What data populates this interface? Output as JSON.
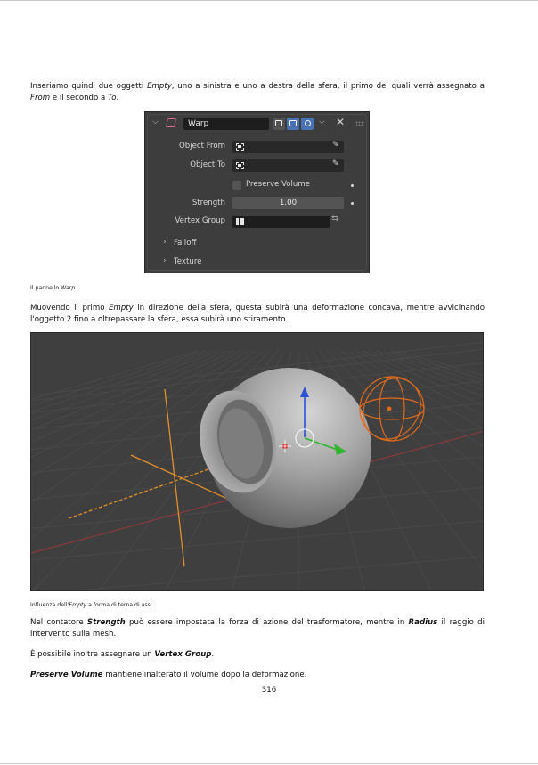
{
  "paragraphs": {
    "p1": {
      "t1": "Inseriamo quindi due oggetti ",
      "e1": "Empty",
      "t2": ", uno a sinistra e uno a destra della sfera, il primo dei quali verrà assegnato a ",
      "e2": "From",
      "t3": " e il secondo a ",
      "e3": "To",
      "t4": "."
    },
    "p2": {
      "t1": "Muovendo il primo ",
      "e1": "Empty",
      "t2": " in direzione della sfera, questa subirà una deformazione concava, mentre avvicinando l'oggetto 2 fino a oltrepassare la sfera, essa subirà uno stiramento."
    },
    "p3": {
      "t1": "Nel contatore ",
      "s1": "Strength",
      "t2": " può essere impostata la forza di azione del trasformatore, mentre in ",
      "s2": "Radius",
      "t3": " il raggio di intervento sulla mesh."
    },
    "p4": {
      "t1": "È possibile inoltre assegnare un ",
      "s1": "Vertex Group",
      "t2": "."
    },
    "p5": {
      "s1": "Preserve Volume",
      "t1": " mantiene inalterato il volume dopo la deformazione."
    }
  },
  "captions": {
    "c1": {
      "t1": "Il pannello ",
      "e1": "Warp"
    },
    "c2": {
      "t1": "Influenza dell'",
      "e1": "Empty",
      "t2": " a forma di terna di assi"
    }
  },
  "panel": {
    "modifier_name": "Warp",
    "rows": {
      "object_from": "Object From",
      "object_to": "Object To",
      "preserve_volume": "Preserve Volume",
      "strength_label": "Strength",
      "strength_value": "1.00",
      "vertex_group": "Vertex Group"
    },
    "subpanels": [
      "Falloff",
      "Texture"
    ],
    "glyphs": {
      "expand": "⌵",
      "collapsed": "›",
      "close": "✕",
      "eyedropper": "✎",
      "swap": "⇆"
    }
  },
  "viewport": {
    "colors": {
      "background": "#3f3f3f",
      "grid": "#4b4b4b",
      "x_axis": "#8c3a3a",
      "empty": "#e0902a",
      "selected_outline": "#e06a1a",
      "z_arrow": "#2a52d4",
      "y_arrow": "#2fb52f"
    }
  },
  "page_number": "316",
  "colors": {
    "panel_bg": "#3d3d3d",
    "panel_field": "#282828",
    "accent_blue": "#4772b3"
  }
}
